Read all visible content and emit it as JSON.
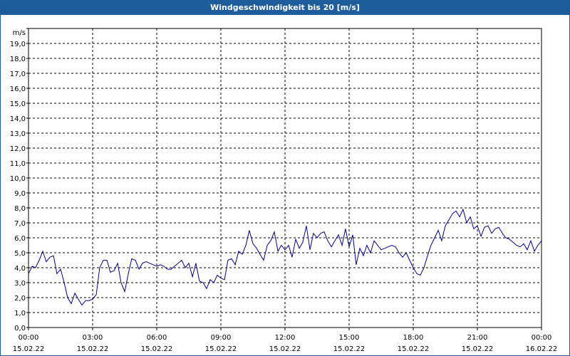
{
  "window": {
    "title": "Windgeschwindigkeit bis 20 [m/s]"
  },
  "chart_data": {
    "type": "line",
    "title": "Windgeschwindigkeit bis 20 [m/s]",
    "ylabel": "m/s",
    "xlabel": "",
    "ylim": [
      0,
      20
    ],
    "xlim": [
      0,
      24
    ],
    "grid": true,
    "y_ticks": [
      "0,0",
      "1,0",
      "2,0",
      "3,0",
      "4,0",
      "5,0",
      "6,0",
      "7,0",
      "8,0",
      "9,0",
      "10,0",
      "11,0",
      "12,0",
      "13,0",
      "14,0",
      "15,0",
      "16,0",
      "17,0",
      "18,0",
      "19,0"
    ],
    "x_ticks": [
      {
        "time": "00:00",
        "date": "15.02.22"
      },
      {
        "time": "03:00",
        "date": "15.02.22"
      },
      {
        "time": "06:00",
        "date": "15.02.22"
      },
      {
        "time": "09:00",
        "date": "15.02.22"
      },
      {
        "time": "12:00",
        "date": "15.02.22"
      },
      {
        "time": "15:00",
        "date": "15.02.22"
      },
      {
        "time": "18:00",
        "date": "15.02.22"
      },
      {
        "time": "21:00",
        "date": "15.02.22"
      },
      {
        "time": "00:00",
        "date": "16.02.22"
      }
    ],
    "line_color": "#00008b",
    "series": [
      {
        "x": [
          0.0,
          0.17,
          0.33,
          0.5,
          0.67,
          0.83,
          1.0,
          1.17,
          1.33,
          1.5,
          1.67,
          1.83,
          2.0,
          2.17,
          2.33,
          2.5,
          2.67,
          2.83,
          3.0,
          3.17,
          3.33,
          3.5,
          3.67,
          3.83,
          4.0,
          4.17,
          4.33,
          4.5,
          4.67,
          4.83,
          5.0,
          5.17,
          5.33,
          5.5,
          5.67,
          5.83,
          6.0,
          6.17,
          6.33,
          6.5,
          6.67,
          6.83,
          7.0,
          7.17,
          7.33,
          7.5,
          7.67,
          7.83,
          8.0,
          8.17,
          8.33,
          8.5,
          8.67,
          8.83,
          9.0,
          9.17,
          9.33,
          9.5,
          9.67,
          9.83,
          10.0,
          10.17,
          10.33,
          10.5,
          10.67,
          10.83,
          11.0,
          11.17,
          11.33,
          11.5,
          11.67,
          11.83,
          12.0,
          12.17,
          12.33,
          12.5,
          12.67,
          12.83,
          13.0,
          13.17,
          13.33,
          13.5,
          13.67,
          13.83,
          14.0,
          14.17,
          14.33,
          14.5,
          14.67,
          14.83,
          15.0,
          15.17,
          15.33,
          15.5,
          15.67,
          15.83,
          16.0,
          16.17,
          16.33,
          16.5,
          16.67,
          16.83,
          17.0,
          17.17,
          17.33,
          17.5,
          17.67,
          17.83,
          18.0,
          18.17,
          18.33,
          18.5,
          18.67,
          18.83,
          19.0,
          19.17,
          19.33,
          19.5,
          19.67,
          19.83,
          20.0,
          20.17,
          20.33,
          20.5,
          20.67,
          20.83,
          21.0,
          21.17,
          21.33,
          21.5,
          21.67,
          21.83,
          22.0,
          22.17,
          22.33,
          22.5,
          22.67,
          22.83,
          23.0,
          23.17,
          23.33,
          23.5,
          23.67,
          23.83,
          24.0
        ],
        "values": [
          3.6,
          4.1,
          4.0,
          4.5,
          5.1,
          4.4,
          4.7,
          4.8,
          3.6,
          3.9,
          3.0,
          2.0,
          1.6,
          2.3,
          1.9,
          1.5,
          1.8,
          1.8,
          1.9,
          2.2,
          4.0,
          4.5,
          4.5,
          3.7,
          3.8,
          4.3,
          3.0,
          2.4,
          3.6,
          4.6,
          4.5,
          3.9,
          4.3,
          4.4,
          4.3,
          4.2,
          4.1,
          4.2,
          4.1,
          3.9,
          3.9,
          4.1,
          4.3,
          4.5,
          4.0,
          4.3,
          3.4,
          4.3,
          3.1,
          3.0,
          2.6,
          3.2,
          3.0,
          3.5,
          3.3,
          3.2,
          4.5,
          4.6,
          4.2,
          5.1,
          4.9,
          5.5,
          6.5,
          5.6,
          5.3,
          4.9,
          4.5,
          5.5,
          5.8,
          6.4,
          5.1,
          5.5,
          5.2,
          5.5,
          4.7,
          5.9,
          5.3,
          5.7,
          6.8,
          5.2,
          6.3,
          6.0,
          6.3,
          6.4,
          5.8,
          5.4,
          5.8,
          6.2,
          5.5,
          6.6,
          5.4,
          6.2,
          4.2,
          5.3,
          4.8,
          5.5,
          5.0,
          5.8,
          5.5,
          5.2,
          5.3,
          5.4,
          5.5,
          5.4,
          5.0,
          4.7,
          5.0,
          4.5,
          4.0,
          3.6,
          3.5,
          4.0,
          4.8,
          5.5,
          6.0,
          6.5,
          5.8,
          6.8,
          7.2,
          7.6,
          7.8,
          7.4,
          7.9,
          7.0,
          7.4,
          6.6,
          6.8,
          6.1,
          6.7,
          6.8,
          6.3,
          6.6,
          6.7,
          6.3,
          6.0,
          5.9,
          5.7,
          5.5,
          5.4,
          5.6,
          5.2,
          5.8,
          5.1,
          5.5,
          5.8
        ]
      }
    ]
  }
}
